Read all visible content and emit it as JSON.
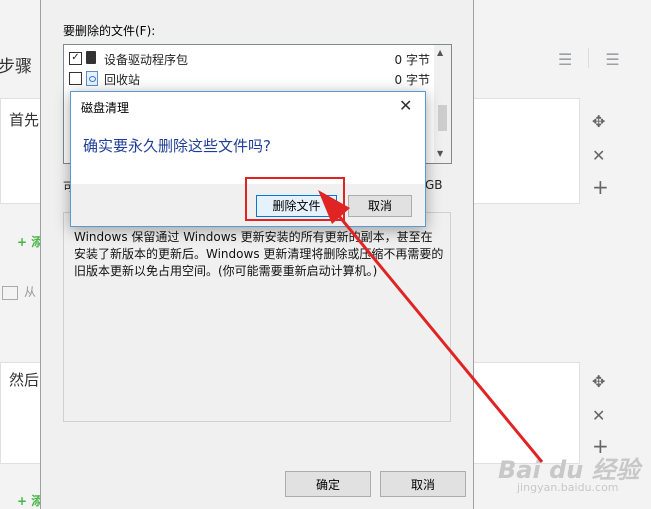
{
  "background": {
    "step_title": "步骤",
    "step1_text": "首先",
    "step2_text": "然后",
    "add_step_partial": "+ 添",
    "image_link_partial": "从",
    "watermark": "Bai du 经验",
    "watermark_sub": "jingyan.baidu.com",
    "controls": {
      "move": "✥",
      "delete": "✕",
      "add": "+"
    }
  },
  "cleanup": {
    "files_label": "要删除的文件(F):",
    "files": [
      {
        "name": "设备驱动程序包",
        "size": "0 字节",
        "checked": true,
        "icon": "driver-icon"
      },
      {
        "name": "回收站",
        "size": "0 字节",
        "checked": false,
        "icon": "recycle-bin-icon"
      }
    ],
    "partial_left": "可",
    "partial_right": "GB",
    "description": "Windows 保留通过 Windows 更新安装的所有更新的副本，甚至在安装了新版本的更新后。Windows 更新清理将删除或压缩不再需要的旧版本更新以免占用空间。(你可能需要重新启动计算机。)",
    "ok_label": "确定",
    "cancel_label": "取消"
  },
  "confirm_dialog": {
    "title": "磁盘清理",
    "close_glyph": "✕",
    "question": "确实要永久删除这些文件吗?",
    "delete_label": "删除文件",
    "cancel_label": "取消"
  },
  "colors": {
    "highlight": "#e02424",
    "arrow": "#e02424",
    "question": "#1e3f99",
    "add_step": "#48b548"
  }
}
